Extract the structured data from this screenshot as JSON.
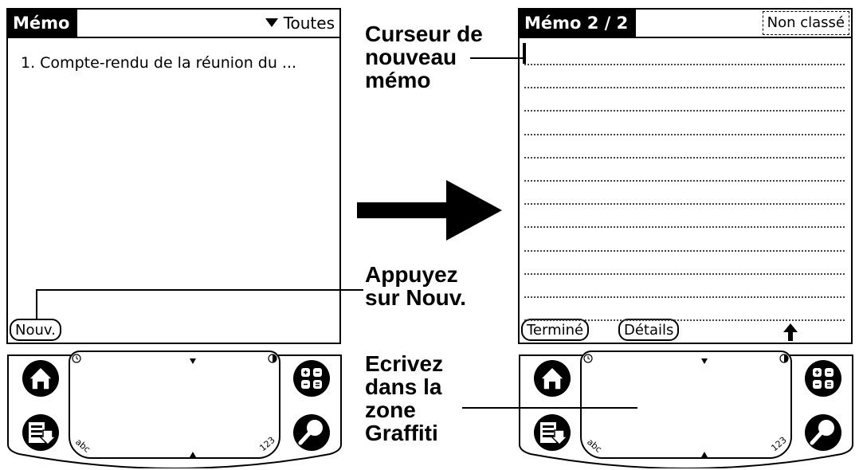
{
  "left_screen": {
    "title": "Mémo",
    "category_dropdown": "Toutes",
    "memo_items": [
      "1. Compte-rendu de la réunion du ..."
    ],
    "new_button": "Nouv."
  },
  "right_screen": {
    "title": "Mémo 2 / 2",
    "category": "Non classé",
    "done_button": "Terminé",
    "details_button": "Détails",
    "line_count": 12
  },
  "silkscreen": {
    "abc_label": "abc",
    "num_label": "123",
    "icons": [
      "home-icon",
      "menu-icon",
      "calculator-icon",
      "find-icon",
      "clock-icon",
      "contrast-icon"
    ]
  },
  "annotations": {
    "cursor_note": [
      "Curseur de",
      "nouveau",
      "mémo"
    ],
    "tap_note": [
      "Appuyez",
      "sur Nouv."
    ],
    "write_note": [
      "Ecrivez",
      "dans la",
      "zone",
      "Graffiti"
    ]
  }
}
